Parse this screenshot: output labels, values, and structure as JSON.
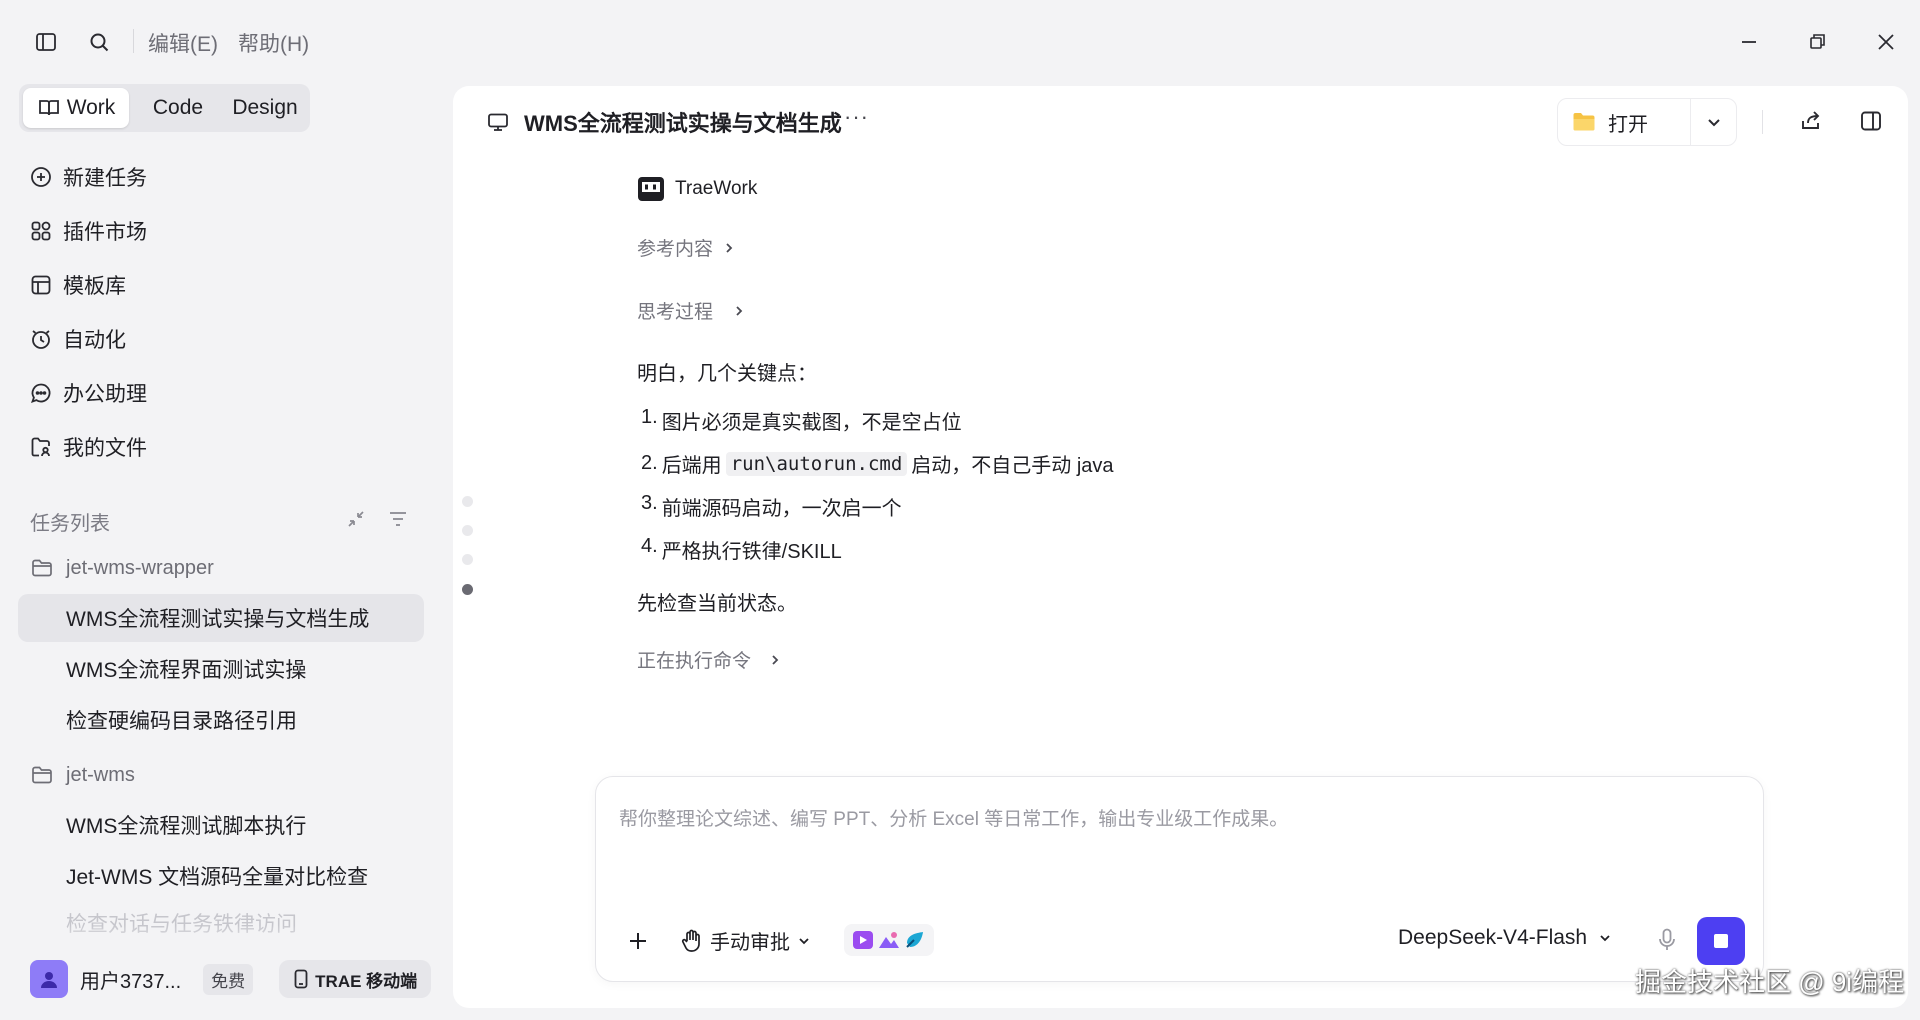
{
  "menu": {
    "edit": "编辑(E)",
    "help": "帮助(H)"
  },
  "modes": [
    {
      "label": "Work",
      "active": true
    },
    {
      "label": "Code",
      "active": false
    },
    {
      "label": "Design",
      "active": false
    }
  ],
  "nav": [
    {
      "label": "新建任务",
      "icon": "plus-circle-icon"
    },
    {
      "label": "插件市场",
      "icon": "apps-icon"
    },
    {
      "label": "模板库",
      "icon": "template-icon"
    },
    {
      "label": "自动化",
      "icon": "clock-icon"
    },
    {
      "label": "办公助理",
      "icon": "chat-icon"
    },
    {
      "label": "我的文件",
      "icon": "files-icon"
    }
  ],
  "task_list": {
    "title": "任务列表",
    "groups": [
      {
        "folder": "jet-wms-wrapper",
        "tasks": [
          "WMS全流程测试实操与文档生成",
          "WMS全流程界面测试实操",
          "检查硬编码目录路径引用"
        ]
      },
      {
        "folder": "jet-wms",
        "tasks": [
          "WMS全流程测试脚本执行",
          "Jet-WMS 文档源码全量对比检查",
          "检查对话与任务铁律访问"
        ]
      }
    ]
  },
  "user": {
    "name": "用户3737...",
    "plan": "免费",
    "mobile_label": "TRAE 移动端"
  },
  "header": {
    "title": "WMS全流程测试实操与文档生成",
    "more": "···",
    "open_label": "打开"
  },
  "chat": {
    "agent_name": "TraeWork",
    "reference": "参考内容",
    "thinking": "思考过程",
    "intro": "明白，几个关键点：",
    "points": [
      {
        "num": "1.",
        "text": "图片必须是真实截图，不是空占位"
      },
      {
        "num": "2.",
        "before": "后端用",
        "code": "run\\autorun.cmd",
        "after": "启动，不自己手动 java"
      },
      {
        "num": "3.",
        "text": "前端源码启动，一次启一个"
      },
      {
        "num": "4.",
        "text": "严格执行铁律/SKILL"
      }
    ],
    "followup": "先检查当前状态。",
    "executing": "正在执行命令"
  },
  "composer": {
    "placeholder": "帮你整理论文综述、编写 PPT、分析 Excel 等日常工作，输出专业级工作成果。",
    "approval": "手动审批",
    "model": "DeepSeek-V4-Flash"
  },
  "watermark": "掘金技术社区 @ 9i编程",
  "colors": {
    "accent": "#4d3ff2",
    "active_task_bg": "#e5e5e9",
    "panel_bg": "#ffffff",
    "window_bg": "#f3f3f5"
  }
}
